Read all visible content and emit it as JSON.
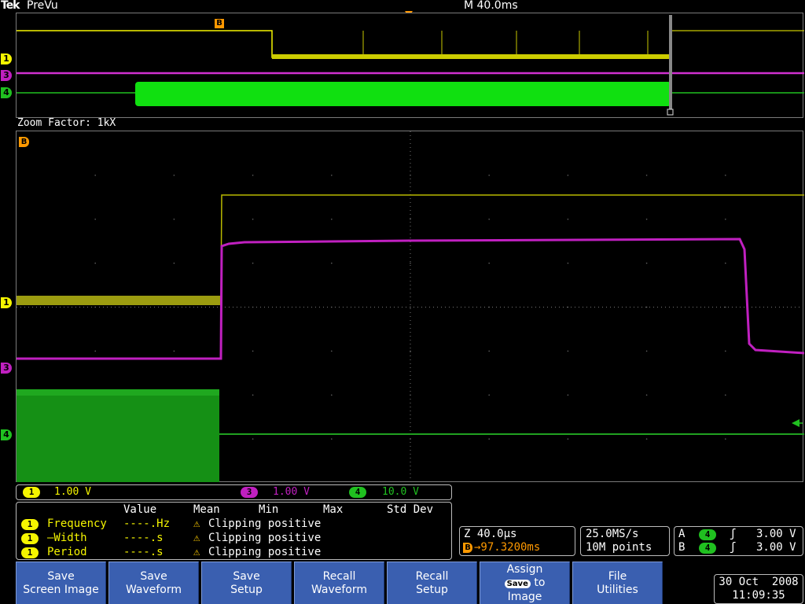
{
  "header": {
    "brand": "Tek",
    "mode": "PreVu",
    "timebase": "M 40.0ms"
  },
  "overview": {
    "bus_marker": "B",
    "channel_markers": [
      "1",
      "3",
      "4"
    ]
  },
  "zoom": {
    "factor_label": "Zoom Factor: 1kX",
    "bus_marker": "B",
    "channel_markers": [
      "1",
      "3",
      "4"
    ]
  },
  "channels": [
    {
      "id": "1",
      "scale": "1.00 V",
      "color": "#f5f500"
    },
    {
      "id": "3",
      "scale": "1.00 V",
      "color": "#c020c0"
    },
    {
      "id": "4",
      "scale": "10.0 V",
      "color": "#20c020"
    }
  ],
  "measurements": {
    "headers": [
      "Value",
      "Mean",
      "Min",
      "Max",
      "Std Dev"
    ],
    "rows": [
      {
        "channel": "1",
        "name": "Frequency",
        "value": "----.Hz",
        "status": "Clipping positive"
      },
      {
        "channel": "1",
        "name": "–Width",
        "value": "----.s",
        "status": "Clipping positive"
      },
      {
        "channel": "1",
        "name": "Period",
        "value": "----.s",
        "status": "Clipping positive"
      }
    ]
  },
  "zoom_readout": {
    "zoom_time": "Z 40.0µs",
    "position_prefix": "B",
    "position": "→97.3200ms"
  },
  "acquisition": {
    "sample_rate": "25.0MS/s",
    "record_length": "10M points"
  },
  "triggers": [
    {
      "label": "A",
      "source": "4",
      "slope": "ʃ",
      "level": "3.00 V"
    },
    {
      "label": "B",
      "source": "4",
      "slope": "ʃ",
      "level": "3.00 V"
    }
  ],
  "buttons": [
    {
      "line1": "Save",
      "line2": "Screen Image"
    },
    {
      "line1": "Save",
      "line2": "Waveform"
    },
    {
      "line1": "Save",
      "line2": "Setup"
    },
    {
      "line1": "Recall",
      "line2": "Waveform"
    },
    {
      "line1": "Recall",
      "line2": "Setup"
    },
    {
      "line1": "Assign",
      "line2": "to",
      "line3": "Image",
      "badge": "Save"
    },
    {
      "line1": "File",
      "line2": "Utilities"
    }
  ],
  "datetime": {
    "date": "30 Oct  2008",
    "time": "11:09:35"
  },
  "colors": {
    "ch1": "#f5f500",
    "ch3": "#c020c0",
    "ch4": "#20c020",
    "button": "#3a5fb0",
    "bus_marker": "#ff9900"
  }
}
